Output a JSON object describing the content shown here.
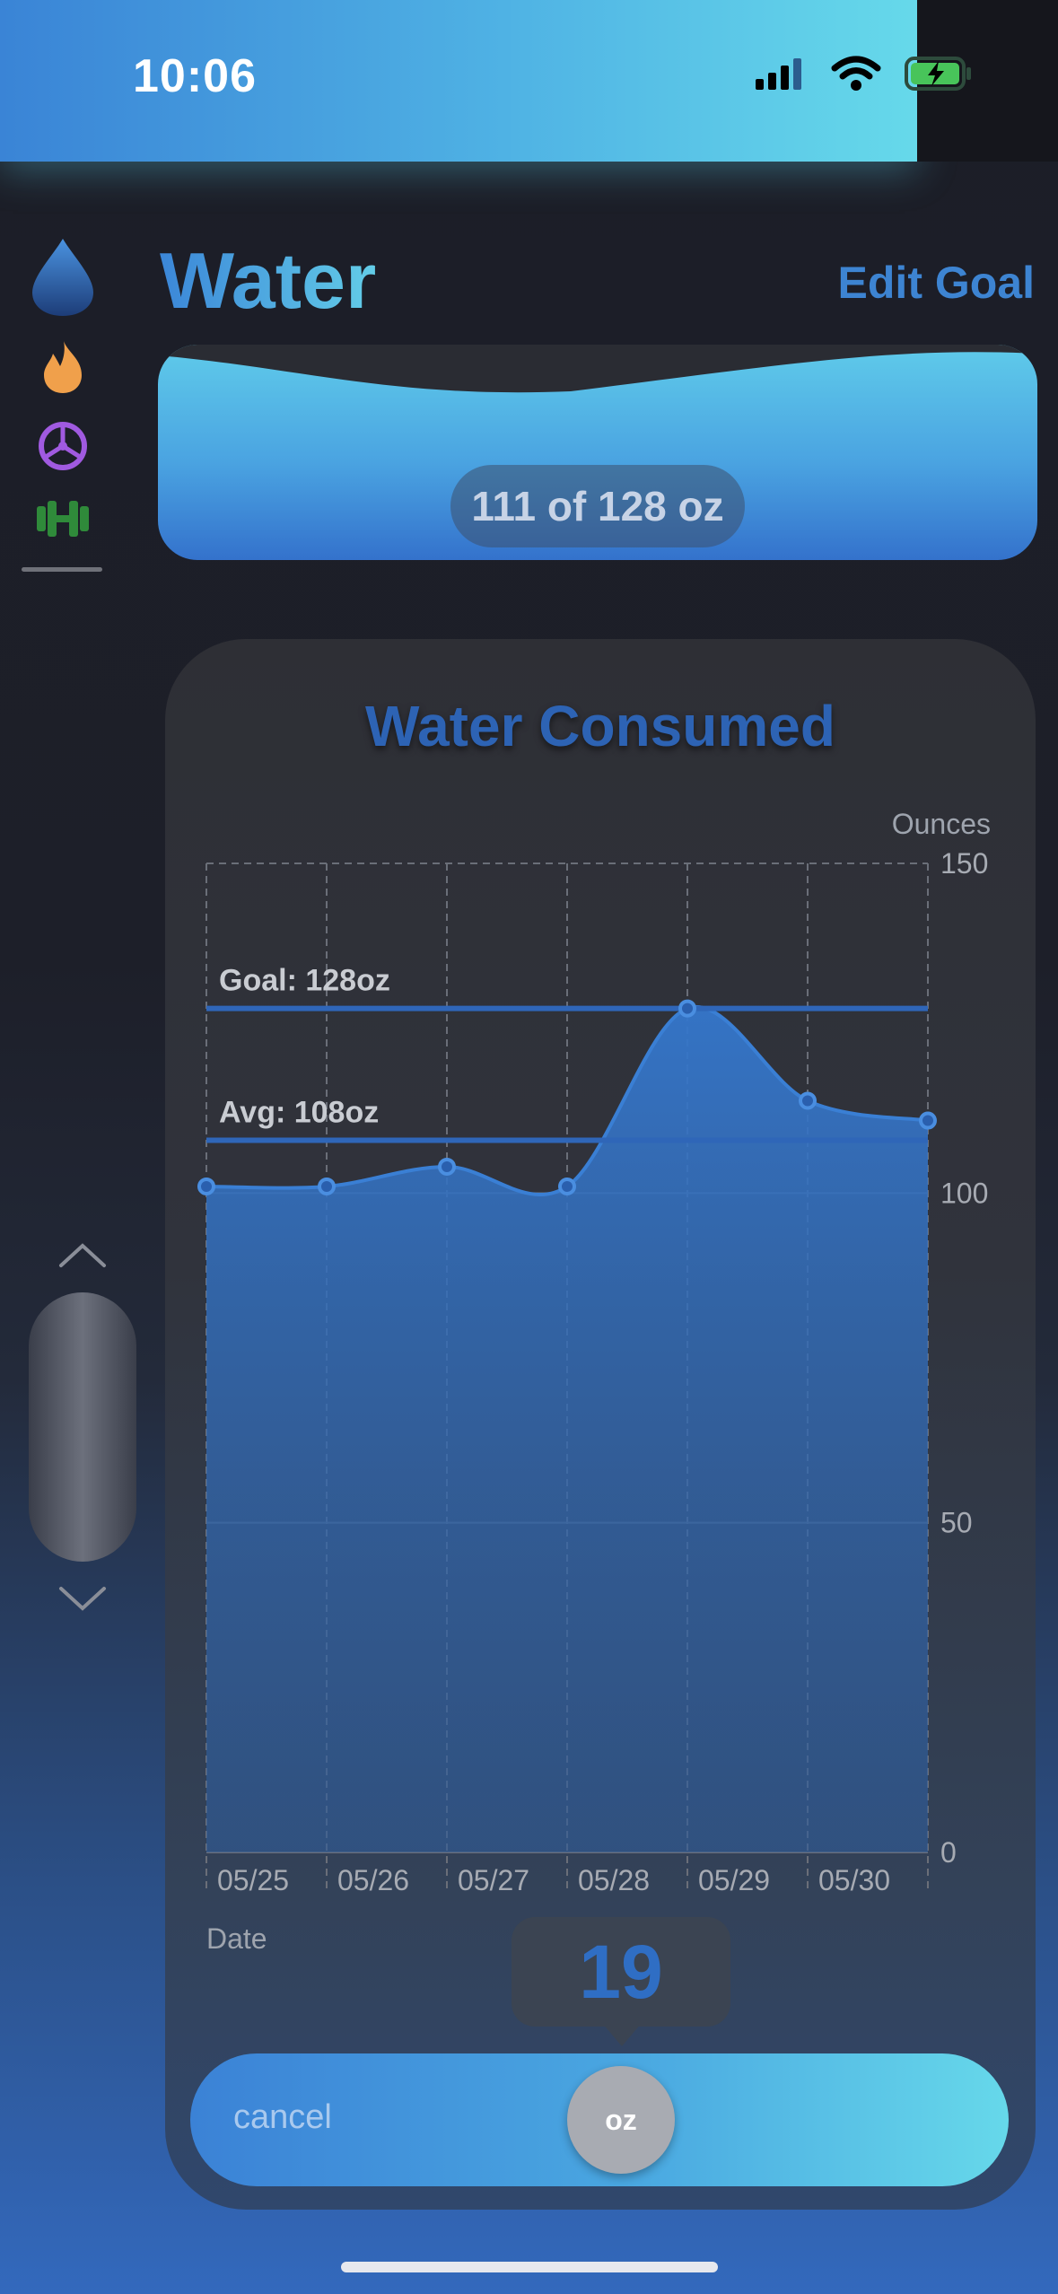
{
  "status_bar": {
    "time": "10:06"
  },
  "header": {
    "title": "Water",
    "edit_goal": "Edit Goal"
  },
  "progress": {
    "label": "111 of 128 oz",
    "current": 111,
    "goal": 128
  },
  "sidebar": {
    "items": [
      {
        "icon": "water-drop-icon",
        "selected": true
      },
      {
        "icon": "flame-icon"
      },
      {
        "icon": "wheel-icon"
      },
      {
        "icon": "dumbbell-icon"
      }
    ]
  },
  "colors": {
    "accent": "#3d84d2",
    "flame": "#f0a04b",
    "wheel": "#a05ae0",
    "dumbbell": "#2f8a3a"
  },
  "chart_data": {
    "type": "area",
    "title": "Water Consumed",
    "xlabel": "Date",
    "ylabel": "Ounces",
    "x": [
      "05/25",
      "05/26",
      "05/27",
      "05/28",
      "05/29",
      "05/30",
      ""
    ],
    "categories": [
      "05/25",
      "05/26",
      "05/27",
      "05/28",
      "05/29",
      "05/30"
    ],
    "series": [
      {
        "values": [
          101,
          101,
          104,
          101,
          128,
          114,
          111
        ]
      }
    ],
    "ylim": [
      0,
      150
    ],
    "yticks": [
      "150",
      "100",
      "50",
      "0"
    ],
    "goal": {
      "label": "Goal: 128oz",
      "value": 128
    },
    "average": {
      "label": "Avg: 108oz",
      "value": 108
    },
    "grid": true
  },
  "picker": {
    "value": "19",
    "unit": "oz",
    "cancel": "cancel"
  }
}
